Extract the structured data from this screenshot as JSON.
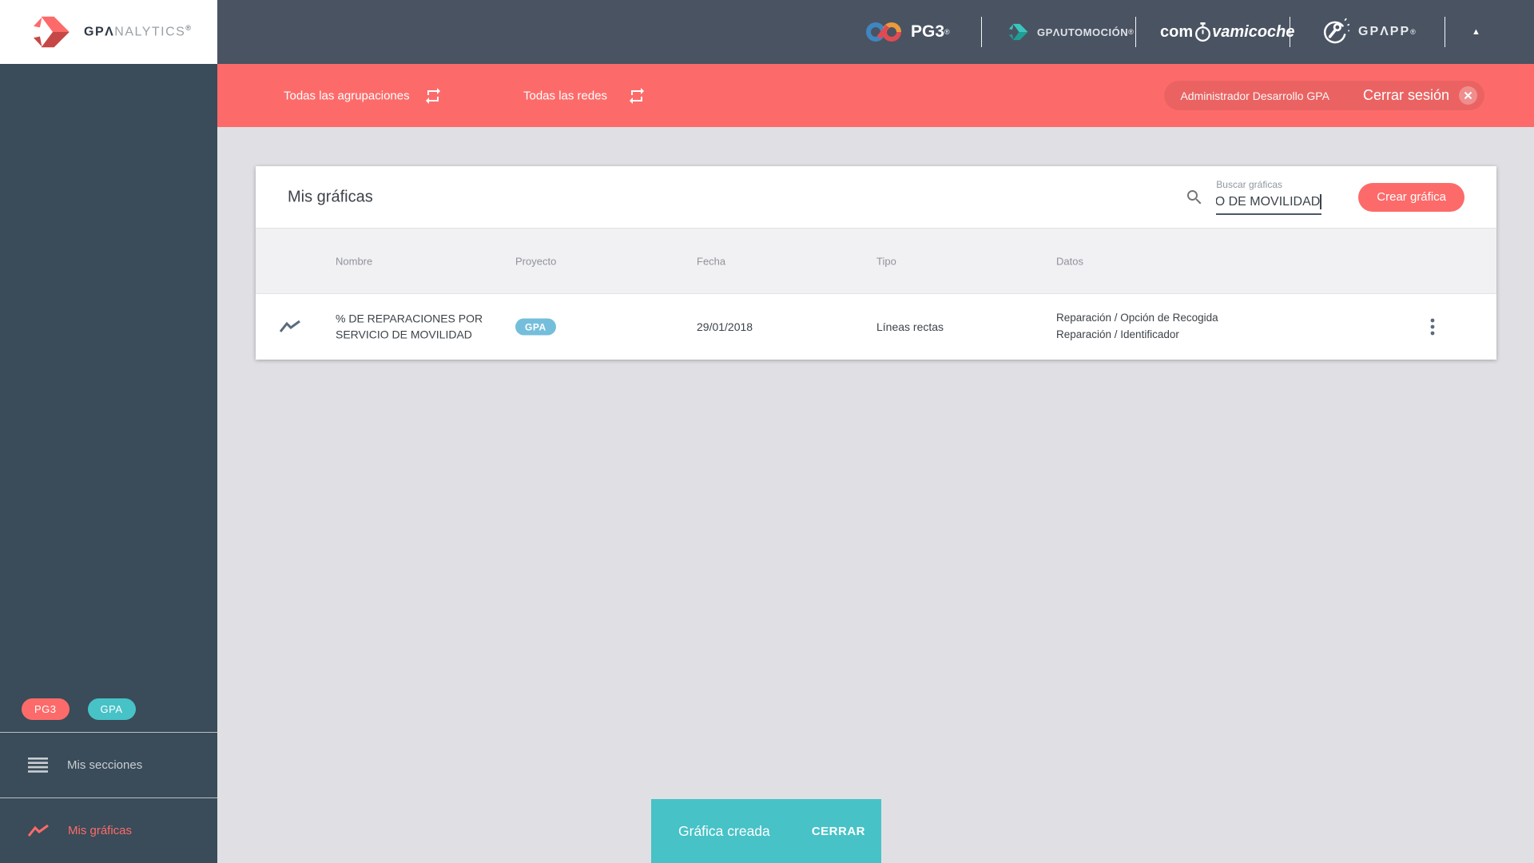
{
  "colors": {
    "header-bg": "#4a5362",
    "sidebar-bg": "#3a4b59",
    "coral": "#fc6b6a",
    "teal": "#47c2c7",
    "badge-blue": "#75bedb",
    "page-bg": "#e0e0e4",
    "table-head-bg": "#f1f1f4"
  },
  "brand": {
    "gpa": "GPΛ",
    "analytics": "NALYTICS",
    "reg": "®"
  },
  "header": {
    "pg3_label": "PG3",
    "pg3_reg": "®",
    "gpautomocion_label": "GPΛUTOMOCIÓN",
    "gpautomocion_reg": "®",
    "comprova_prefix": "com",
    "comprova_suffix": "vamicoche",
    "gpapp_label": "GPΛPP",
    "gpapp_reg": "®",
    "collapse_icon": "▲"
  },
  "filterbar": {
    "groupings_label": "Todas las agrupaciones",
    "networks_label": "Todas las redes",
    "user_name": "Administrador Desarrollo GPA",
    "logout_label": "Cerrar sesión"
  },
  "sidebar": {
    "badge_pg3": "PG3",
    "badge_gpa": "GPA",
    "sections_label": "Mis secciones",
    "charts_label": "Mis gráficas"
  },
  "card": {
    "title": "Mis gráficas",
    "search_label": "Buscar gráficas",
    "search_value": "O DE MOVILIDAD",
    "create_button_label": "Crear gráfica"
  },
  "table": {
    "columns": [
      "Nombre",
      "Proyecto",
      "Fecha",
      "Tipo",
      "Datos"
    ],
    "row": {
      "name": "% DE REPARACIONES POR SERVICIO DE MOVILIDAD",
      "project_badge": "GPA",
      "date": "29/01/2018",
      "type": "Líneas rectas",
      "data_items": [
        "Reparación / Opción de Recogida",
        "Reparación / Identificador"
      ]
    }
  },
  "toast": {
    "message": "Gráfica creada",
    "action_label": "CERRAR"
  }
}
